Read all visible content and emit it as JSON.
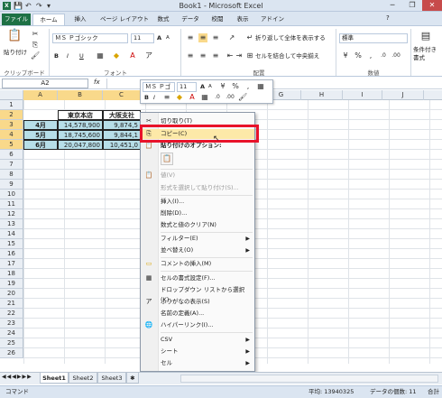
{
  "titlebar": {
    "title": "Book1 - Microsoft Excel",
    "qat": [
      "💾",
      "↶",
      "↷",
      "▾"
    ],
    "app_icon": "X"
  },
  "tabs": [
    "ファイル",
    "ホーム",
    "挿入",
    "ページ レイアウト",
    "数式",
    "データ",
    "校閲",
    "表示",
    "アドイン"
  ],
  "ribbon": {
    "clipboard": {
      "paste": "貼り付け",
      "label": "クリップボード"
    },
    "font": {
      "name": "ＭＳ Ｐゴシック",
      "size": "11",
      "label": "フォント",
      "bold": "B",
      "italic": "I",
      "underline": "U",
      "grow": "A",
      "shrink": "A"
    },
    "alignment": {
      "wrap": "折り返して全体を表示する",
      "merge": "セルを結合して中央揃え",
      "label": "配置"
    },
    "number": {
      "format": "標準",
      "label": "数値"
    },
    "styles": {
      "conditional": "条件付き書式"
    }
  },
  "formula_bar": {
    "name_box": "A2",
    "fx": "fx"
  },
  "columns": [
    "A",
    "B",
    "C",
    "D",
    "E",
    "F",
    "G",
    "H",
    "I",
    "J"
  ],
  "rows": [
    "1",
    "2",
    "3",
    "4",
    "5",
    "6",
    "7",
    "8",
    "9",
    "10",
    "11",
    "12",
    "13",
    "14",
    "15",
    "16",
    "17",
    "18",
    "19",
    "20",
    "21",
    "22",
    "23",
    "24",
    "25",
    "26"
  ],
  "table": {
    "headers": [
      "東京本店",
      "大阪支社"
    ],
    "months": [
      "4月",
      "5月",
      "6月"
    ],
    "tokyo": [
      "14,578,900",
      "18,745,600",
      "20,047,800"
    ],
    "osaka": [
      "9,874,5",
      "9,844,1",
      "10,451,0"
    ]
  },
  "mini_toolbar": {
    "font": "ＭＳ Ｐゴ",
    "size": "11",
    "bold": "B",
    "italic": "I"
  },
  "context_menu": {
    "items": [
      {
        "label": "切り取り(T)",
        "icon": "✂"
      },
      {
        "label": "コピー(C)",
        "icon": "⎘"
      },
      {
        "label": "貼り付けのオプション:",
        "icon": "📋"
      },
      {
        "label": "",
        "icon": ""
      },
      {
        "label": "値(V)",
        "icon": "",
        "disabled": true
      },
      {
        "label": "形式を選択して貼り付け(S)...",
        "icon": "",
        "disabled": true
      },
      {
        "label": "挿入(I)...",
        "icon": ""
      },
      {
        "label": "削除(D)...",
        "icon": ""
      },
      {
        "label": "数式と値のクリア(N)",
        "icon": ""
      },
      {
        "label": "フィルター(E)",
        "icon": "",
        "submenu": true
      },
      {
        "label": "並べ替え(O)",
        "icon": "",
        "submenu": true
      },
      {
        "label": "コメントの挿入(M)",
        "icon": "▭"
      },
      {
        "label": "セルの書式設定(F)...",
        "icon": "▦"
      },
      {
        "label": "ドロップダウン リストから選択(K)...",
        "icon": ""
      },
      {
        "label": "ふりがなの表示(S)",
        "icon": "ア"
      },
      {
        "label": "名前の定義(A)...",
        "icon": ""
      },
      {
        "label": "ハイパーリンク(I)...",
        "icon": "🌐"
      },
      {
        "label": "CSV",
        "icon": "",
        "submenu": true
      },
      {
        "label": "シート",
        "icon": "",
        "submenu": true
      },
      {
        "label": "セル",
        "icon": "",
        "submenu": true
      }
    ]
  },
  "sheets": [
    "Sheet1",
    "Sheet2",
    "Sheet3"
  ],
  "status": {
    "mode": "コマンド",
    "average": "平均: 13940325",
    "count": "データの個数: 11",
    "sum": "合計"
  }
}
